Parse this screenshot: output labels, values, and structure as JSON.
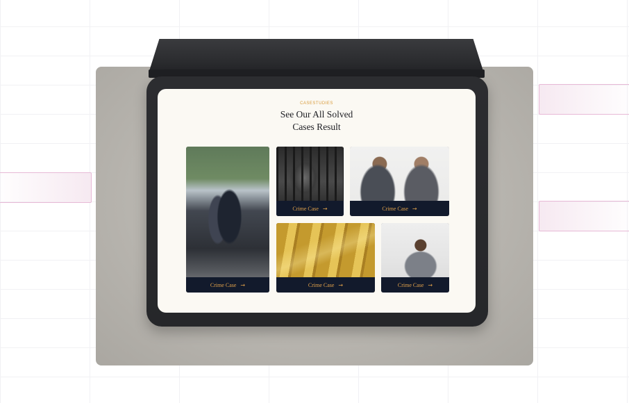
{
  "section": {
    "eyebrow": "CASESTUDIES",
    "title_line1": "See Our All Solved",
    "title_line2": "Cases Result"
  },
  "cases": [
    {
      "label": "Crime Case",
      "photo": "arrest-scene-photo"
    },
    {
      "label": "Crime Case",
      "photo": "prisoner-behind-bars-photo"
    },
    {
      "label": "Crime Case",
      "photo": "couple-arguing-photo"
    },
    {
      "label": "Crime Case",
      "photo": "gold-bars-photo"
    },
    {
      "label": "Crime Case",
      "photo": "distressed-woman-photo"
    }
  ],
  "icons": {
    "arrow": "arrow-right-icon"
  },
  "colors": {
    "accent": "#e0a14a",
    "card_bar": "#121a2c",
    "screen_bg": "#fbf9f3",
    "heading": "#1c1d22"
  }
}
